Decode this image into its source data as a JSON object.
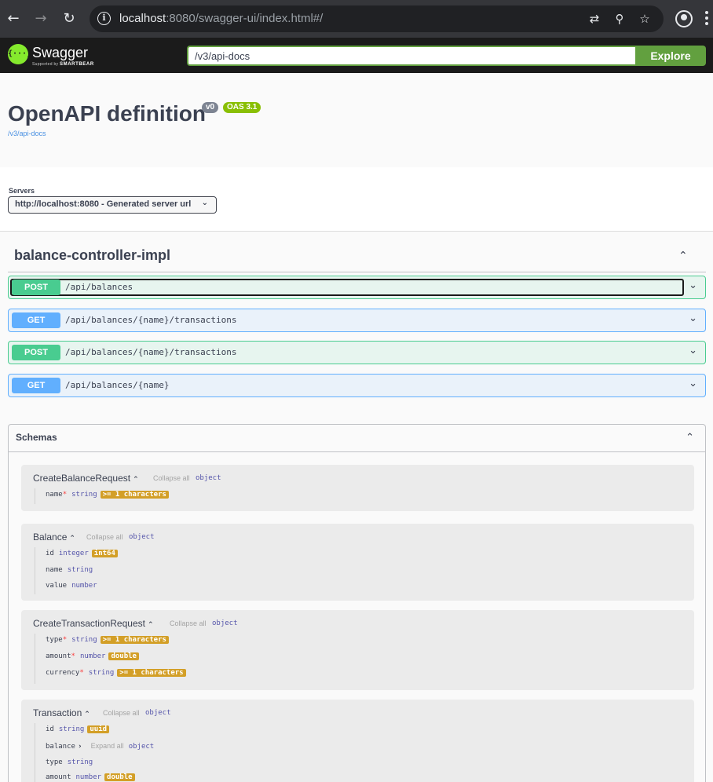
{
  "browser": {
    "url_host": "localhost",
    "url_rest": ":8080/swagger-ui/index.html#/"
  },
  "topbar": {
    "logo_name": "Swagger",
    "logo_supported": "Supported by",
    "logo_brand": "SMARTBEAR",
    "spec_url": "/v3/api-docs",
    "explore_label": "Explore"
  },
  "info": {
    "title": "OpenAPI definition",
    "version": "v0",
    "oas": "OAS 3.1",
    "spec_link": "/v3/api-docs"
  },
  "servers": {
    "label": "Servers",
    "selected": "http://localhost:8080 - Generated server url"
  },
  "tag": {
    "name": "balance-controller-impl"
  },
  "operations": [
    {
      "method": "POST",
      "path": "/api/balances"
    },
    {
      "method": "GET",
      "path": "/api/balances/{name}/transactions"
    },
    {
      "method": "POST",
      "path": "/api/balances/{name}/transactions"
    },
    {
      "method": "GET",
      "path": "/api/balances/{name}"
    }
  ],
  "schemas": {
    "title": "Schemas",
    "collapse_all": "Collapse all",
    "expand_all": "Expand all",
    "models": [
      {
        "name": "CreateBalanceRequest",
        "type": "object",
        "props": [
          {
            "name": "name",
            "required": "*",
            "type": "string",
            "format": ">= 1 characters"
          }
        ]
      },
      {
        "name": "Balance",
        "type": "object",
        "props": [
          {
            "name": "id",
            "type": "integer",
            "format": "int64"
          },
          {
            "name": "name",
            "type": "string"
          },
          {
            "name": "value",
            "type": "number"
          }
        ]
      },
      {
        "name": "CreateTransactionRequest",
        "type": "object",
        "props": [
          {
            "name": "type",
            "required": "*",
            "type": "string",
            "format": ">= 1 characters"
          },
          {
            "name": "amount",
            "required": "*",
            "type": "number",
            "format": "double"
          },
          {
            "name": "currency",
            "required": "*",
            "type": "string",
            "format": ">= 1 characters"
          }
        ]
      },
      {
        "name": "Transaction",
        "type": "object",
        "props": [
          {
            "name": "id",
            "type": "string",
            "format": "uuid"
          },
          {
            "name": "balance",
            "type": "object"
          },
          {
            "name": "type",
            "type": "string"
          },
          {
            "name": "amount",
            "type": "number",
            "format": "double"
          }
        ]
      }
    ]
  },
  "colors": {
    "post": "#49cc90",
    "get": "#61affe",
    "explore": "#62a03f",
    "format_badge": "#d39f27"
  }
}
